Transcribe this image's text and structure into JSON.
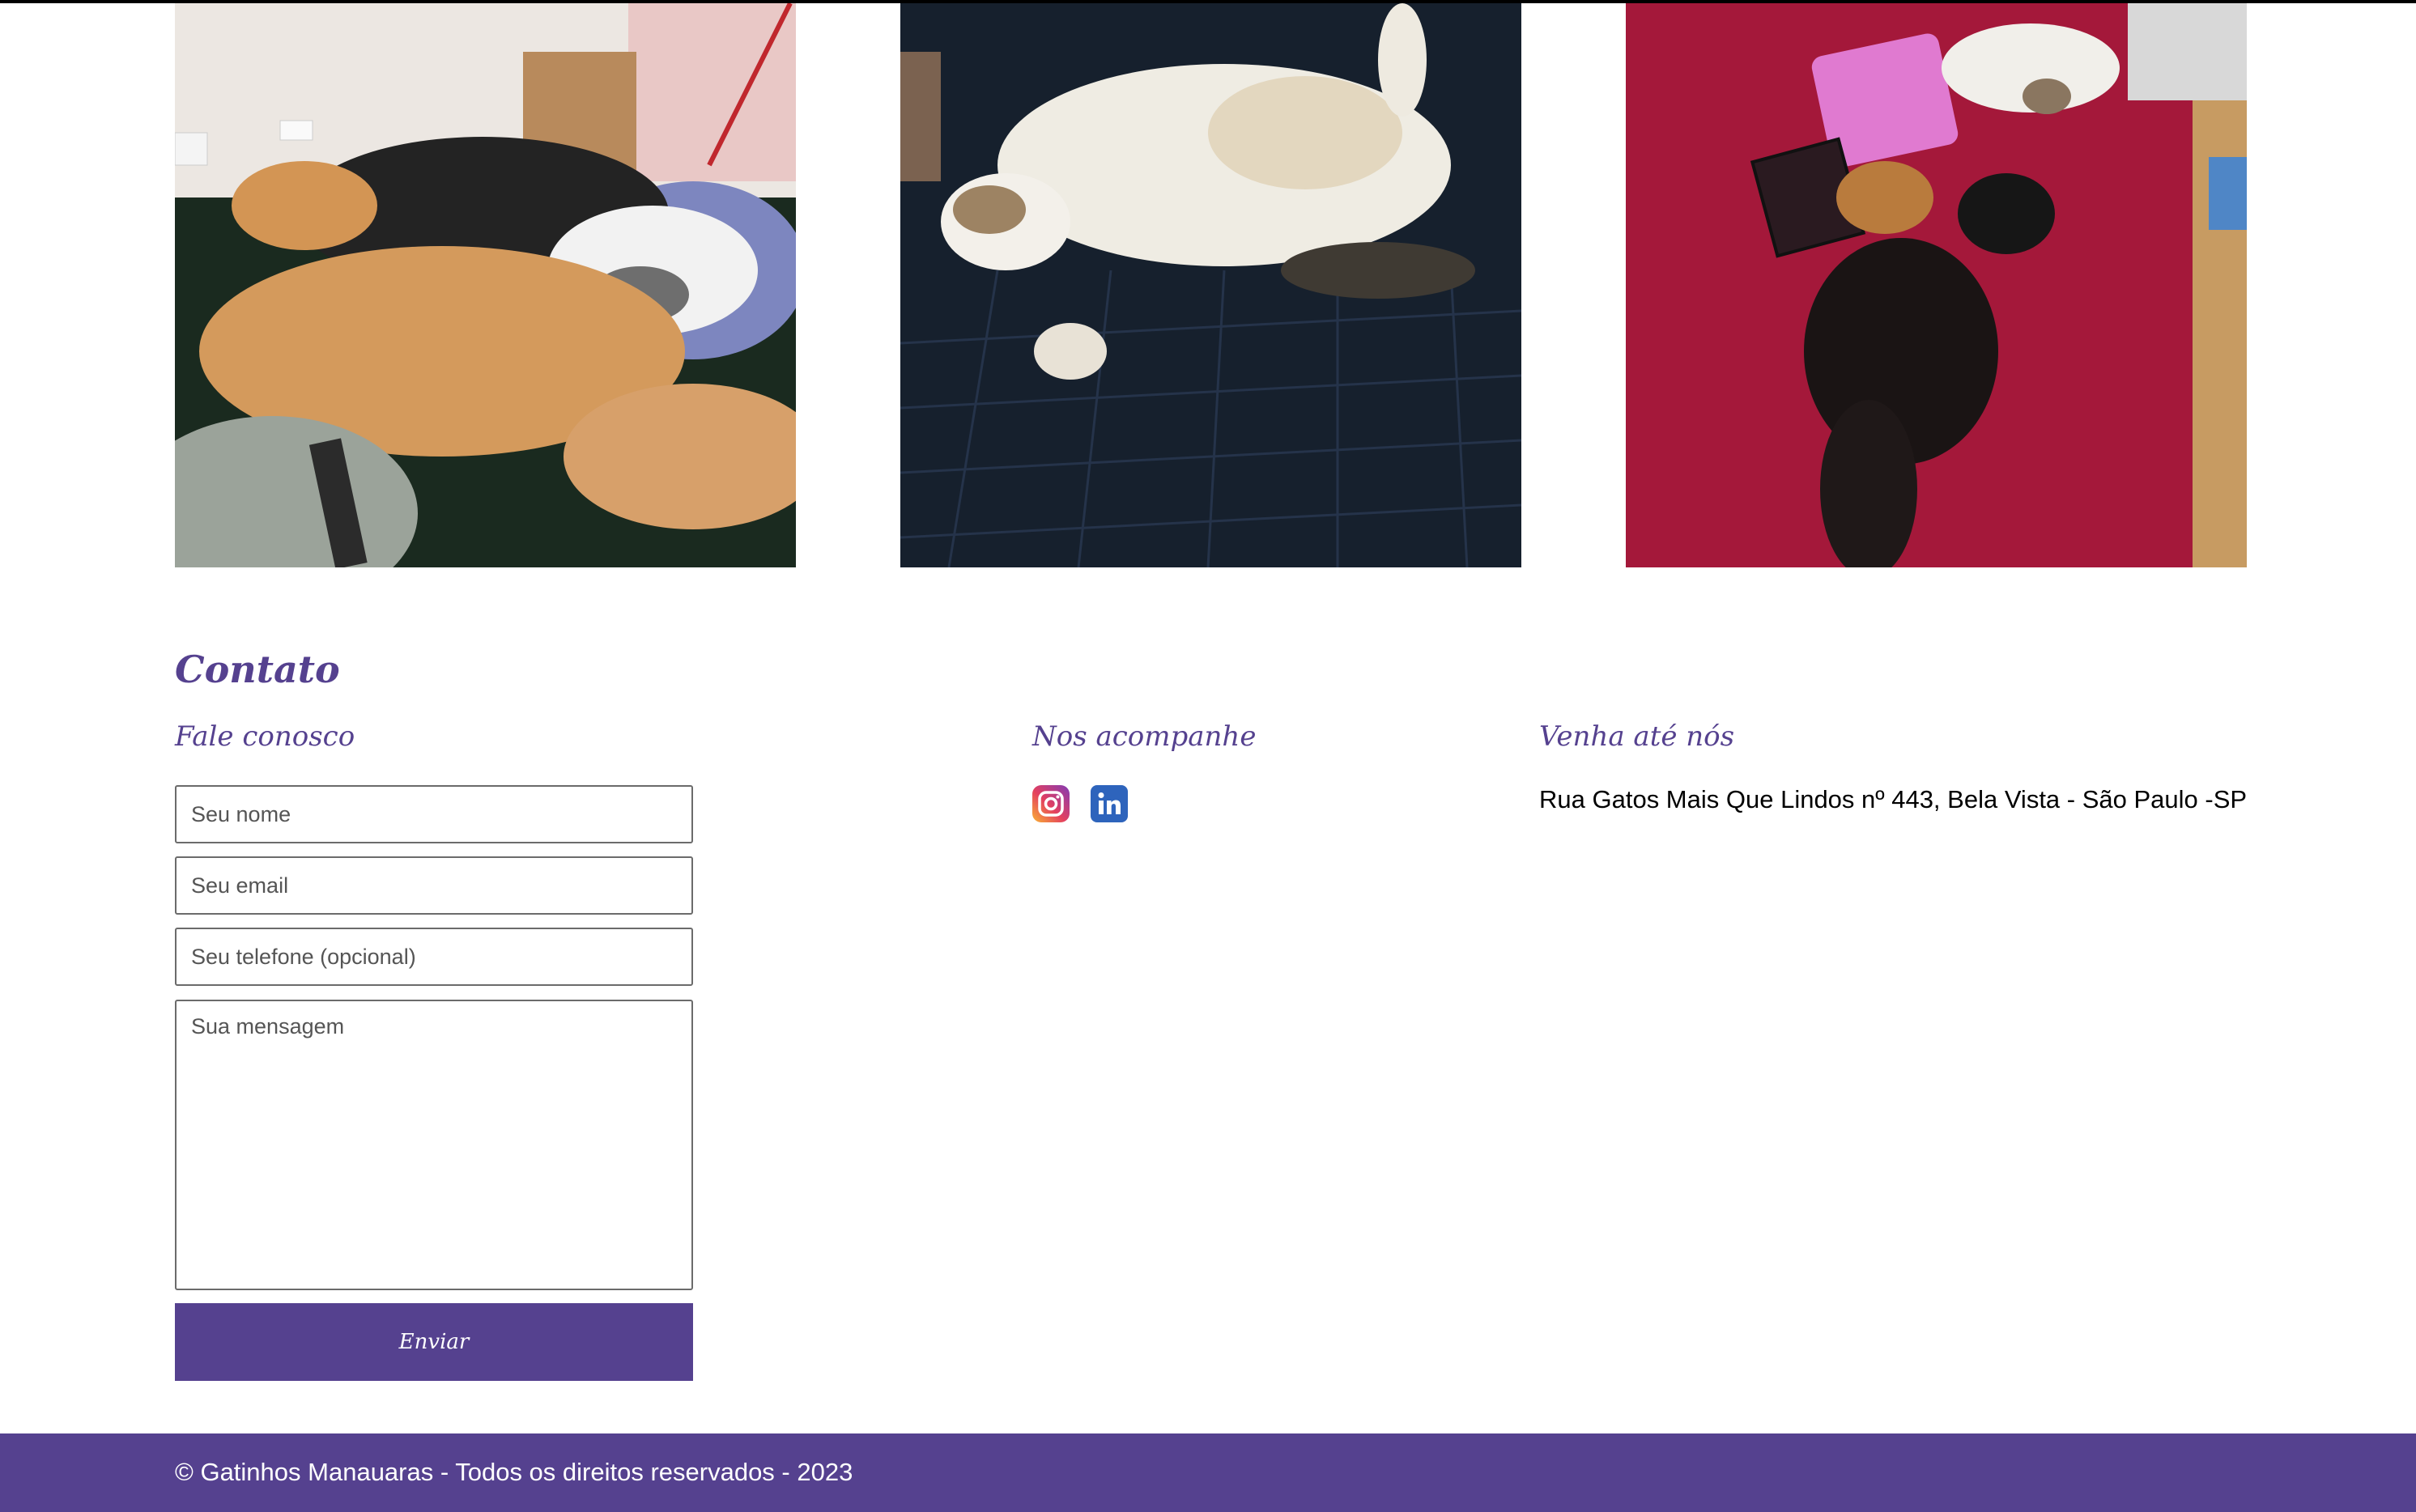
{
  "gallery": {
    "photos": [
      {
        "alt": "Gatos dormindo na cama"
      },
      {
        "alt": "Gato branco deitado na coberta"
      },
      {
        "alt": "Gatos na coberta vermelha"
      }
    ]
  },
  "contact": {
    "title": "Contato",
    "form": {
      "title": "Fale conosco",
      "name_placeholder": "Seu nome",
      "email_placeholder": "Seu email",
      "phone_placeholder": "Seu telefone (opcional)",
      "message_placeholder": "Sua mensagem",
      "submit_label": "Enviar"
    },
    "social": {
      "title": "Nos acompanhe",
      "icons": [
        "instagram-icon",
        "linkedin-icon"
      ]
    },
    "location": {
      "title": "Venha até nós",
      "address": "Rua Gatos Mais Que Lindos nº 443, Bela Vista - São Paulo -SP"
    }
  },
  "footer": {
    "text": "© Gatinhos Manauaras - Todos os direitos reservados - 2023"
  },
  "colors": {
    "accent": "#55418f",
    "linkedin": "#2e64bc"
  }
}
